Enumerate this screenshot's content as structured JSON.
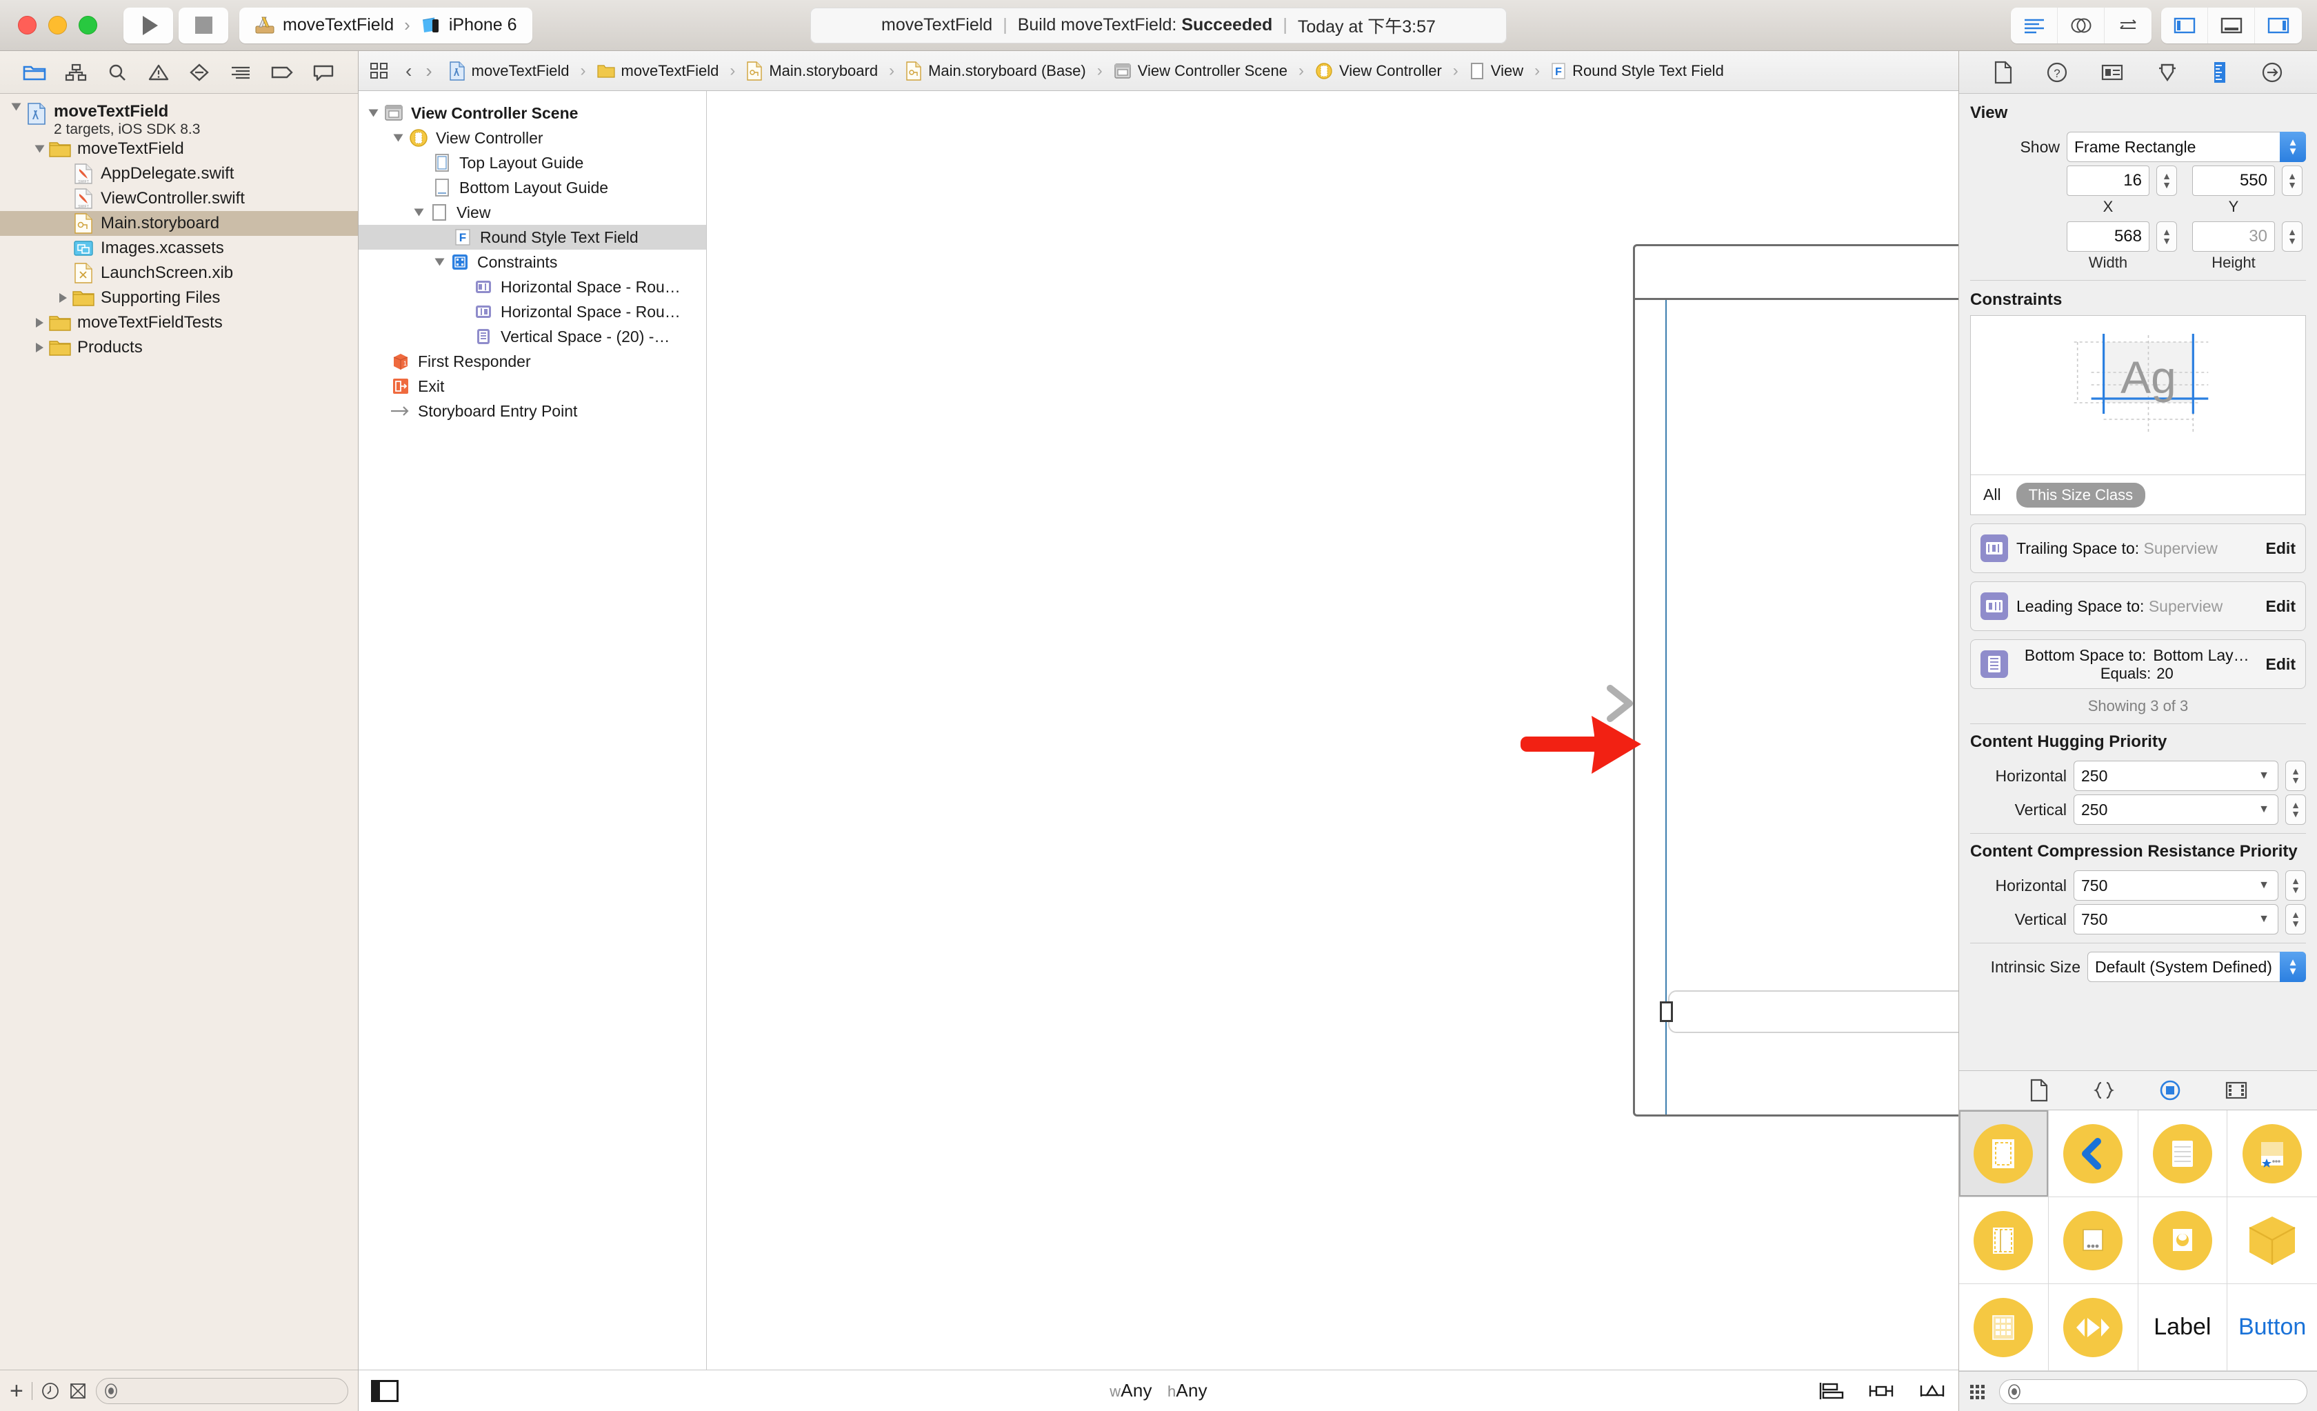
{
  "titlebar": {
    "scheme_project": "moveTextField",
    "scheme_device": "iPhone 6",
    "status_project": "moveTextField",
    "status_action": "Build moveTextField:",
    "status_result": "Succeeded",
    "status_time": "Today at 下午3:57",
    "sep": "|"
  },
  "navigator": {
    "tabs": [
      "folder-icon",
      "sourcecontrol-icon",
      "search-icon",
      "warning-icon",
      "test-icon",
      "debug-icon",
      "breakpoint-icon",
      "report-icon"
    ],
    "tree": [
      {
        "label": "moveTextField",
        "sublabel": "2 targets, iOS SDK 8.3",
        "icon": "project-icon",
        "indent": 0,
        "twisty": "open",
        "bold": true,
        "selected": false
      },
      {
        "label": "moveTextField",
        "icon": "folder-icon",
        "indent": 1,
        "twisty": "open",
        "bold": false,
        "selected": false
      },
      {
        "label": "AppDelegate.swift",
        "icon": "swift-icon",
        "indent": 2,
        "twisty": "none",
        "bold": false,
        "selected": false
      },
      {
        "label": "ViewController.swift",
        "icon": "swift-icon",
        "indent": 2,
        "twisty": "none",
        "bold": false,
        "selected": false
      },
      {
        "label": "Main.storyboard",
        "icon": "storyboard-icon",
        "indent": 2,
        "twisty": "none",
        "bold": false,
        "selected": true
      },
      {
        "label": "Images.xcassets",
        "icon": "xcassets-icon",
        "indent": 2,
        "twisty": "none",
        "bold": false,
        "selected": false
      },
      {
        "label": "LaunchScreen.xib",
        "icon": "xib-icon",
        "indent": 2,
        "twisty": "none",
        "bold": false,
        "selected": false
      },
      {
        "label": "Supporting Files",
        "icon": "folder-icon",
        "indent": 1.6,
        "twisty": "closed",
        "bold": false,
        "selected": false
      },
      {
        "label": "moveTextFieldTests",
        "icon": "folder-icon",
        "indent": 0.6,
        "twisty": "closed",
        "bold": false,
        "selected": false
      },
      {
        "label": "Products",
        "icon": "folder-icon",
        "indent": 0.6,
        "twisty": "closed",
        "bold": false,
        "selected": false
      }
    ],
    "filter_placeholder": ""
  },
  "jumpbar": {
    "crumbs": [
      {
        "label": "moveTextField",
        "icon": "project-icon"
      },
      {
        "label": "moveTextField",
        "icon": "folder-icon"
      },
      {
        "label": "Main.storyboard",
        "icon": "storyboard-icon"
      },
      {
        "label": "Main.storyboard (Base)",
        "icon": "storyboard-icon"
      },
      {
        "label": "View Controller Scene",
        "icon": "scene-icon"
      },
      {
        "label": "View Controller",
        "icon": "viewcontroller-icon"
      },
      {
        "label": "View",
        "icon": "view-icon"
      },
      {
        "label": "Round Style Text Field",
        "icon": "textfield-icon"
      }
    ],
    "separator": "›"
  },
  "outline": [
    {
      "label": "View Controller Scene",
      "icon": "scene-icon",
      "indent": 0,
      "twisty": "open",
      "bold": true,
      "selected": false
    },
    {
      "label": "View Controller",
      "icon": "viewcontroller-icon",
      "indent": 1,
      "twisty": "open",
      "bold": false,
      "selected": false
    },
    {
      "label": "Top Layout Guide",
      "icon": "toplayout-icon",
      "indent": 2,
      "twisty": "none",
      "bold": false,
      "selected": false
    },
    {
      "label": "Bottom Layout Guide",
      "icon": "bottomlayout-icon",
      "indent": 2,
      "twisty": "none",
      "bold": false,
      "selected": false
    },
    {
      "label": "View",
      "icon": "view-icon",
      "indent": 2,
      "twisty": "open",
      "bold": false,
      "selected": false
    },
    {
      "label": "Round Style Text Field",
      "icon": "textfield-icon",
      "indent": 3,
      "twisty": "none",
      "bold": false,
      "selected": true
    },
    {
      "label": "Constraints",
      "icon": "constraints-icon",
      "indent": 2.6,
      "twisty": "open",
      "bold": false,
      "selected": false
    },
    {
      "label": "Horizontal Space - Rou…",
      "icon": "hconstraint-icon",
      "indent": 3.6,
      "twisty": "none",
      "bold": false,
      "selected": false
    },
    {
      "label": "Horizontal Space - Rou…",
      "icon": "hconstraint2-icon",
      "indent": 3.6,
      "twisty": "none",
      "bold": false,
      "selected": false
    },
    {
      "label": "Vertical Space - (20) -…",
      "icon": "vconstraint-icon",
      "indent": 3.6,
      "twisty": "none",
      "bold": false,
      "selected": false
    },
    {
      "label": "First Responder",
      "icon": "firstresponder-icon",
      "indent": 1,
      "twisty": "none",
      "bold": false,
      "selected": false
    },
    {
      "label": "Exit",
      "icon": "exit-icon",
      "indent": 1,
      "twisty": "none",
      "bold": false,
      "selected": false
    },
    {
      "label": "Storyboard Entry Point",
      "icon": "entrypoint-icon",
      "indent": 1,
      "twisty": "none",
      "bold": false,
      "selected": false
    }
  ],
  "canvas": {
    "size_class_w": "wAny",
    "size_class_h": "hAny",
    "w_prefix": "w",
    "h_prefix": "h",
    "w_value": "Any",
    "h_value": "Any"
  },
  "inspector": {
    "tabs": [
      "file-inspector-icon",
      "quick-help-icon",
      "identity-inspector-icon",
      "attributes-inspector-icon",
      "size-inspector-icon",
      "connections-inspector-icon"
    ],
    "view_section_title": "View",
    "show_label": "Show",
    "show_value": "Frame Rectangle",
    "x_value": "16",
    "y_value": "550",
    "width_value": "568",
    "height_value": "30",
    "x_label": "X",
    "y_label": "Y",
    "width_label": "Width",
    "height_label": "Height",
    "constraints_title": "Constraints",
    "ag_text": "Ag",
    "all_label": "All",
    "size_class_label": "This Size Class",
    "constraint_rows": [
      {
        "title": "Trailing Space to:",
        "target": "Superview",
        "target_muted": true,
        "edit": "Edit",
        "icon": "trailing-constraint-icon",
        "sub_label": "",
        "sub_value": ""
      },
      {
        "title": "Leading Space to:",
        "target": "Superview",
        "target_muted": true,
        "edit": "Edit",
        "icon": "leading-constraint-icon",
        "sub_label": "",
        "sub_value": ""
      },
      {
        "title": "Bottom Space to:",
        "target": "Bottom Lay…",
        "target_muted": false,
        "edit": "Edit",
        "icon": "bottom-constraint-icon",
        "sub_label": "Equals:",
        "sub_value": "20"
      }
    ],
    "showing_text": "Showing 3 of 3",
    "hugging_title": "Content Hugging Priority",
    "hugging_h_label": "Horizontal",
    "hugging_h_value": "250",
    "hugging_v_label": "Vertical",
    "hugging_v_value": "250",
    "compression_title": "Content Compression Resistance Priority",
    "compression_h_label": "Horizontal",
    "compression_h_value": "750",
    "compression_v_label": "Vertical",
    "compression_v_value": "750",
    "intrinsic_label": "Intrinsic Size",
    "intrinsic_value": "Default (System Defined)"
  },
  "library": {
    "tabs": [
      "file-template-library-icon",
      "code-snippet-library-icon",
      "object-library-icon",
      "media-library-icon"
    ],
    "items": [
      {
        "name": "view-controller-object",
        "type": "circle",
        "selected": true
      },
      {
        "name": "navigation-controller-object",
        "type": "circle",
        "selected": false
      },
      {
        "name": "table-view-controller-object",
        "type": "circle",
        "selected": false
      },
      {
        "name": "tab-bar-controller-object",
        "type": "circle",
        "selected": false
      },
      {
        "name": "split-view-controller-object",
        "type": "circle",
        "selected": false
      },
      {
        "name": "page-view-controller-object",
        "type": "circle",
        "selected": false
      },
      {
        "name": "avkit-player-controller-object",
        "type": "circle",
        "selected": false
      },
      {
        "name": "object-cube-object",
        "type": "cube",
        "selected": false
      },
      {
        "name": "collection-view-controller-object",
        "type": "circle",
        "selected": false
      },
      {
        "name": "av-player-object",
        "type": "circle",
        "selected": false
      },
      {
        "name": "label-object",
        "type": "text",
        "label": "Label",
        "color": "#111111",
        "selected": false
      },
      {
        "name": "button-object",
        "type": "text",
        "label": "Button",
        "color": "#1a72d8",
        "selected": false
      }
    ],
    "filter_placeholder": ""
  },
  "colors": {
    "accent_blue": "#2b7fe0",
    "guide_blue": "#3d7eae",
    "library_yellow": "#f5c842",
    "annotation_red": "#f22113",
    "selection_tan": "#cbbda8"
  }
}
